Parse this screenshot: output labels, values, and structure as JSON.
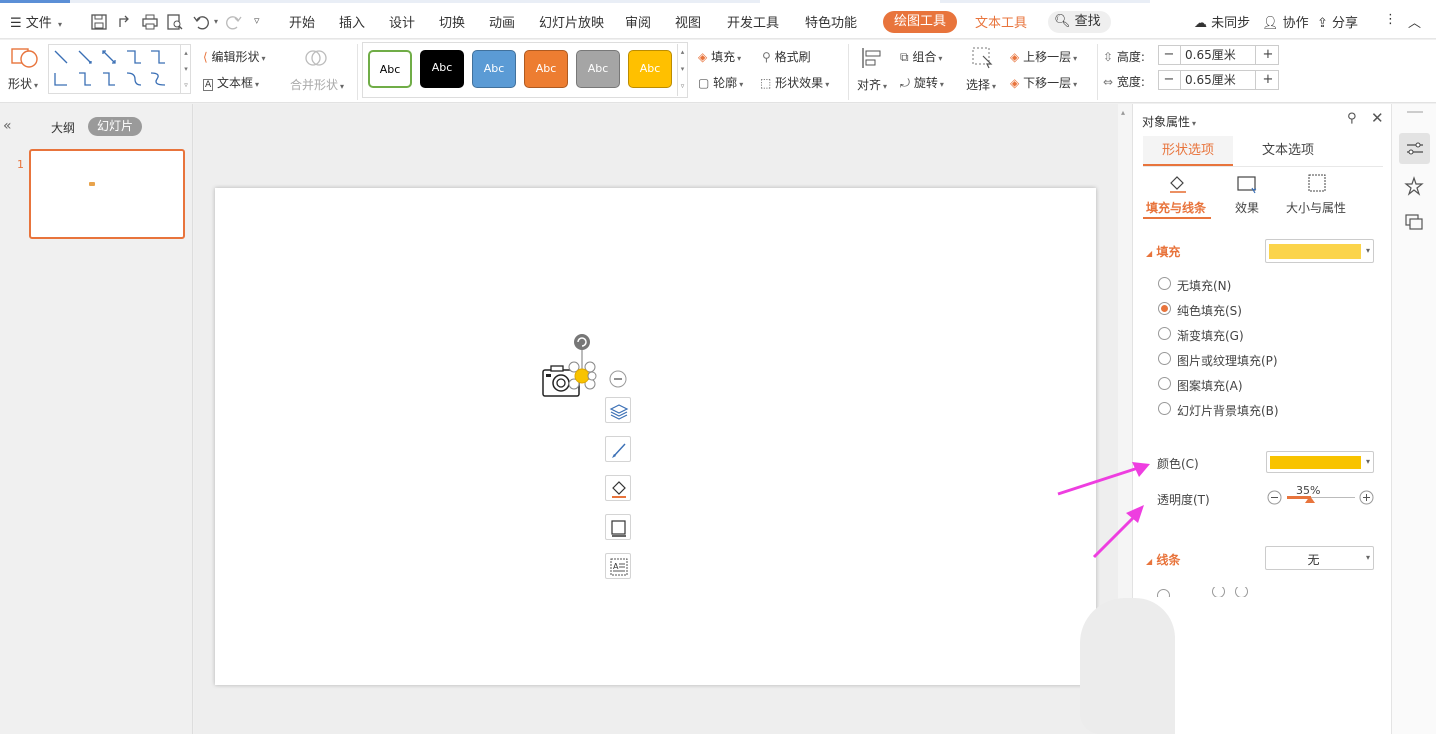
{
  "menu": {
    "file": "文件",
    "tabs": [
      "开始",
      "插入",
      "设计",
      "切换",
      "动画",
      "幻灯片放映",
      "审阅",
      "视图",
      "开发工具",
      "特色功能"
    ],
    "active_tab": "绘图工具",
    "text_tool_tab": "文本工具",
    "search": "查找",
    "sync": "未同步",
    "collab": "协作",
    "share": "分享"
  },
  "ribbon": {
    "shape": "形状",
    "edit_shape": "编辑形状",
    "textbox": "文本框",
    "merge_shape": "合并形状",
    "style_sample": "Abc",
    "fill": "填充",
    "format_painter": "格式刷",
    "outline": "轮廓",
    "shape_effect": "形状效果",
    "align": "对齐",
    "group": "组合",
    "rotate": "旋转",
    "select": "选择",
    "bring_forward": "上移一层",
    "send_backward": "下移一层",
    "height_label": "高度:",
    "height_value": "0.65厘米",
    "width_label": "宽度:",
    "width_value": "0.65厘米"
  },
  "left_panel": {
    "outline_tab": "大纲",
    "slides_tab": "幻灯片",
    "slide_number": "1"
  },
  "right_panel": {
    "title": "对象属性",
    "tab_shape": "形状选项",
    "tab_text": "文本选项",
    "sub_fill_line": "填充与线条",
    "sub_effect": "效果",
    "sub_size": "大小与属性",
    "fill_section": "填充",
    "fill_options": [
      "无填充(N)",
      "纯色填充(S)",
      "渐变填充(G)",
      "图片或纹理填充(P)",
      "图案填充(A)",
      "幻灯片背景填充(B)"
    ],
    "fill_selected_index": 1,
    "color_label": "颜色(C)",
    "transparency_label": "透明度(T)",
    "transparency_value": "35%",
    "line_section": "线条",
    "line_value": "无"
  },
  "colors": {
    "accent": "#e8743c",
    "fill_color": "#f8c300",
    "fill_preview": "#fbd44b",
    "annotation_arrow": "#ee3ee0"
  }
}
